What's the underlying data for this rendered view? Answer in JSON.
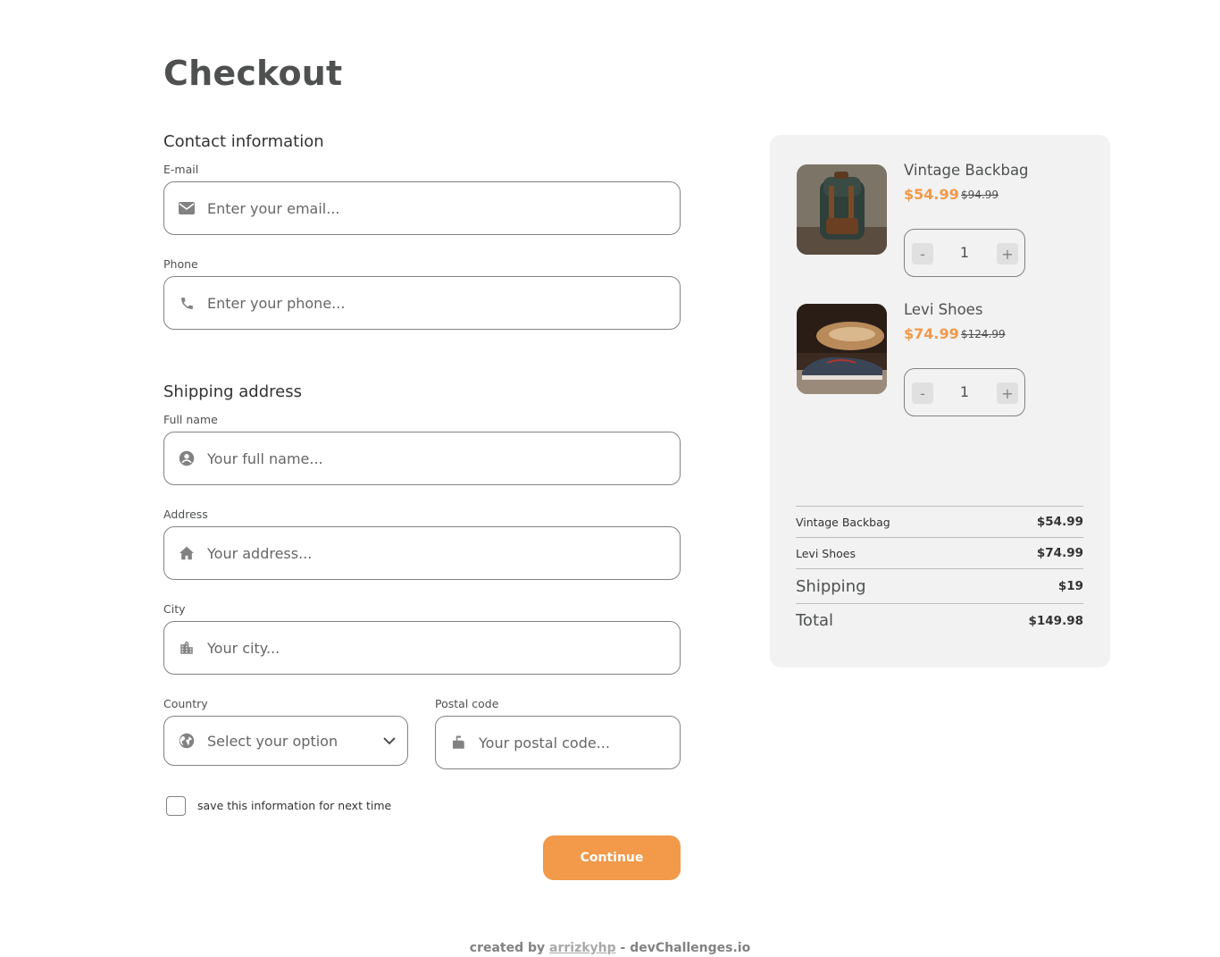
{
  "page": {
    "title": "Checkout"
  },
  "contact": {
    "title": "Contact information",
    "email": {
      "label": "E-mail",
      "placeholder": "Enter your email..."
    },
    "phone": {
      "label": "Phone",
      "placeholder": "Enter your phone..."
    }
  },
  "shipping": {
    "title": "Shipping address",
    "full_name": {
      "label": "Full name",
      "placeholder": "Your full name..."
    },
    "address": {
      "label": "Address",
      "placeholder": "Your address..."
    },
    "city": {
      "label": "City",
      "placeholder": "Your city..."
    },
    "country": {
      "label": "Country",
      "selected": "Select your option"
    },
    "postal": {
      "label": "Postal code",
      "placeholder": "Your postal code..."
    }
  },
  "save_info": {
    "label": "save this information for next time"
  },
  "continue_label": "Continue",
  "footer": {
    "prefix": "created by",
    "author": "arrizkyhp",
    "suffix": "- devChallenges.io"
  },
  "cart": {
    "items": [
      {
        "name": "Vintage Backbag",
        "price": "$54.99",
        "old_price": "$94.99",
        "qty": "1",
        "minus": "-",
        "plus": "+"
      },
      {
        "name": "Levi Shoes",
        "price": "$74.99",
        "old_price": "$124.99",
        "qty": "1",
        "minus": "-",
        "plus": "+"
      }
    ],
    "summary": [
      {
        "label": "Vintage Backbag",
        "value": "$54.99"
      },
      {
        "label": "Levi Shoes",
        "value": "$74.99"
      },
      {
        "label": "Shipping",
        "value": "$19"
      },
      {
        "label": "Total",
        "value": "$149.98"
      }
    ]
  },
  "colors": {
    "accent": "#f2994a",
    "panel": "#f2f2f2",
    "text": "#4e5150",
    "border": "#828282"
  }
}
